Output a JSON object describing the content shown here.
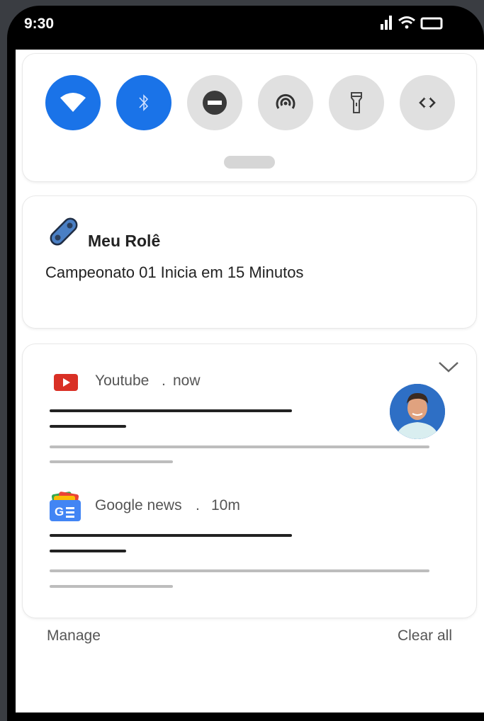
{
  "status_bar": {
    "time": "9:30",
    "icons": [
      "signal-icon",
      "wifi-icon",
      "battery-icon"
    ]
  },
  "quick_settings": {
    "tiles": [
      {
        "name": "wifi",
        "icon": "wifi-icon",
        "active": true
      },
      {
        "name": "bluetooth",
        "icon": "bluetooth-icon",
        "active": true
      },
      {
        "name": "do-not-disturb",
        "icon": "do-not-disturb-icon",
        "active": false
      },
      {
        "name": "hotspot",
        "icon": "hotspot-icon",
        "active": false
      },
      {
        "name": "flashlight",
        "icon": "flashlight-icon",
        "active": false
      },
      {
        "name": "auto-rotate",
        "icon": "auto-rotate-icon",
        "active": false
      }
    ],
    "colors": {
      "active": "#1a73e8",
      "inactive": "#e0e0e0"
    }
  },
  "app_notification": {
    "app_name": "Meu Rolê",
    "message": "Campeonato 01 Inicia em 15 Minutos",
    "icon": "skateboard-icon"
  },
  "grouped_notifications": [
    {
      "source": "Youtube",
      "separator": ".",
      "time": "now",
      "icon": "youtube-icon",
      "has_avatar": true
    },
    {
      "source": "Google news",
      "separator": ".",
      "time": "10m",
      "icon": "google-news-icon",
      "has_avatar": false
    }
  ],
  "footer": {
    "manage_label": "Manage",
    "clear_all_label": "Clear all"
  }
}
